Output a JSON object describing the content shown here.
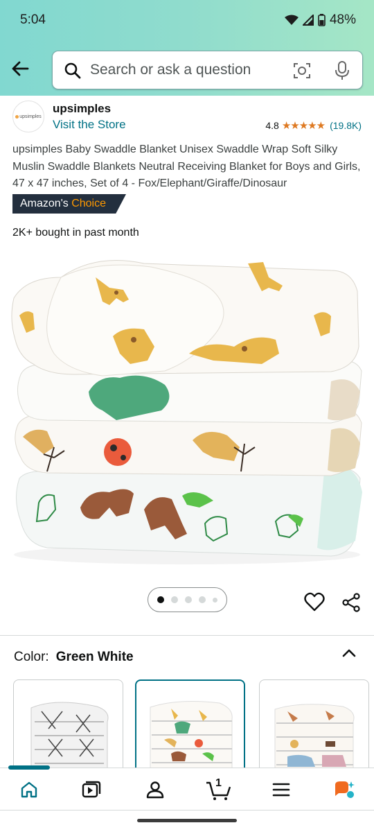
{
  "status": {
    "time": "5:04",
    "battery": "48%"
  },
  "search": {
    "placeholder": "Search or ask a question"
  },
  "brand": {
    "logo_text": "upsimples",
    "name": "upsimples",
    "visit_label": "Visit the Store"
  },
  "rating": {
    "score": "4.8",
    "stars": "★★★★★",
    "count": "(19.8K)"
  },
  "product": {
    "title": "upsimples Baby Swaddle Blanket Unisex Swaddle Wrap Soft Silky Muslin Swaddle Blankets Neutral Receiving Blanket for Boys and Girls, 47 x 47 inches, Set of 4 - Fox/Elephant/Giraffe/Dinosaur",
    "badge_prefix": "Amazon's",
    "badge_choice": "Choice",
    "bought": "2K+ bought in past month"
  },
  "variants": {
    "label": "Color:",
    "selected": "Green White"
  },
  "colors": {
    "accent": "#007185",
    "star": "#de7921",
    "badge_bg": "#232f3e",
    "badge_choice": "#ff9900"
  },
  "tabbar": {
    "items": [
      "home-icon",
      "video-icon",
      "account-icon",
      "cart-icon",
      "menu-icon",
      "rufus-icon"
    ],
    "cart_count": "1"
  }
}
